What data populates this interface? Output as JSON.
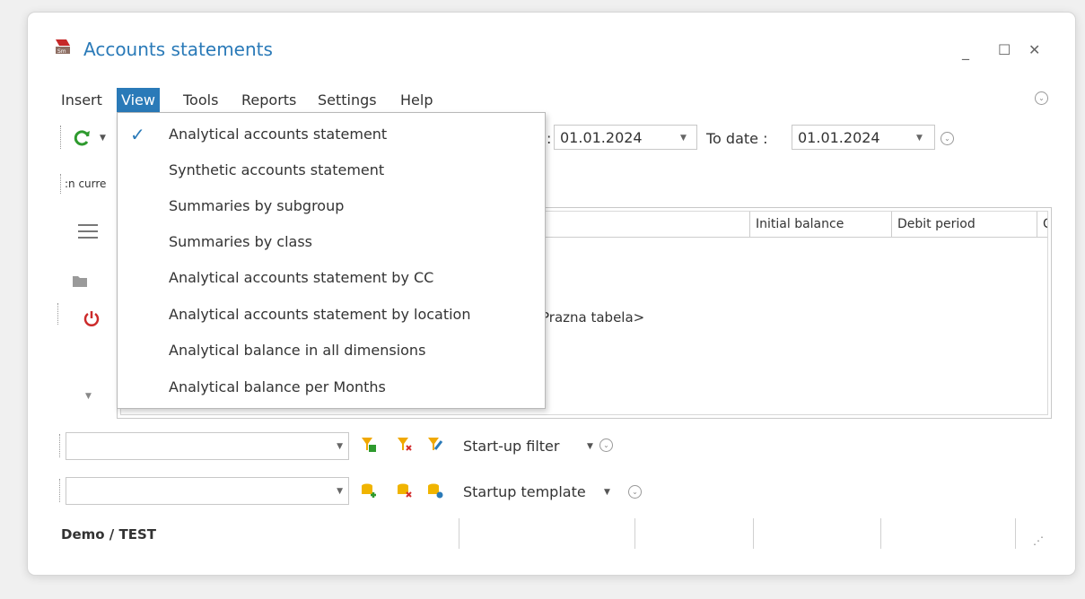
{
  "window": {
    "title": "Accounts statements"
  },
  "menubar": {
    "items": [
      {
        "label": "Insert"
      },
      {
        "label": "View",
        "active": true
      },
      {
        "label": "Tools"
      },
      {
        "label": "Reports"
      },
      {
        "label": "Settings"
      },
      {
        "label": "Help"
      }
    ]
  },
  "toolbar": {
    "date_separator": ":",
    "from_date": "01.01.2024",
    "to_date_label": "To date :",
    "to_date": "01.01.2024",
    "currency_fragment": ":n curre"
  },
  "grid": {
    "columns": [
      "Initial balance",
      "Debit period",
      "C"
    ],
    "empty_text": "Prazna tabela>"
  },
  "filter_bar": {
    "label": "Start-up filter"
  },
  "template_bar": {
    "label": "Startup template"
  },
  "status": {
    "label": "Demo / TEST"
  },
  "view_menu": {
    "items": [
      {
        "label": "Analytical accounts statement",
        "checked": true
      },
      {
        "label": "Synthetic accounts statement"
      },
      {
        "label": "Summaries by subgroup"
      },
      {
        "label": "Summaries by class"
      },
      {
        "label": "Analytical accounts statement by CC"
      },
      {
        "label": "Analytical accounts statement by location"
      },
      {
        "label": "Analytical balance in all dimensions"
      },
      {
        "label": "Analytical balance per Months"
      }
    ]
  },
  "colors": {
    "accent": "#2a7ab8",
    "refresh": "#2e9a2e",
    "power": "#cc2a2a"
  }
}
